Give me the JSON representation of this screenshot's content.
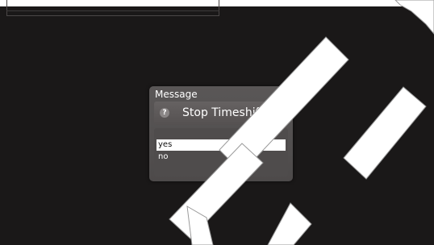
{
  "dialog": {
    "title": "Message",
    "icon": "question-icon",
    "question": "Stop Timeshift?",
    "options": [
      {
        "label": "yes",
        "selected": true
      },
      {
        "label": "no",
        "selected": false
      }
    ]
  },
  "colors": {
    "screen_background": "#1a1818",
    "dialog_background": "#575454",
    "selection": "#ffffff",
    "watermark": "#ffffff"
  }
}
